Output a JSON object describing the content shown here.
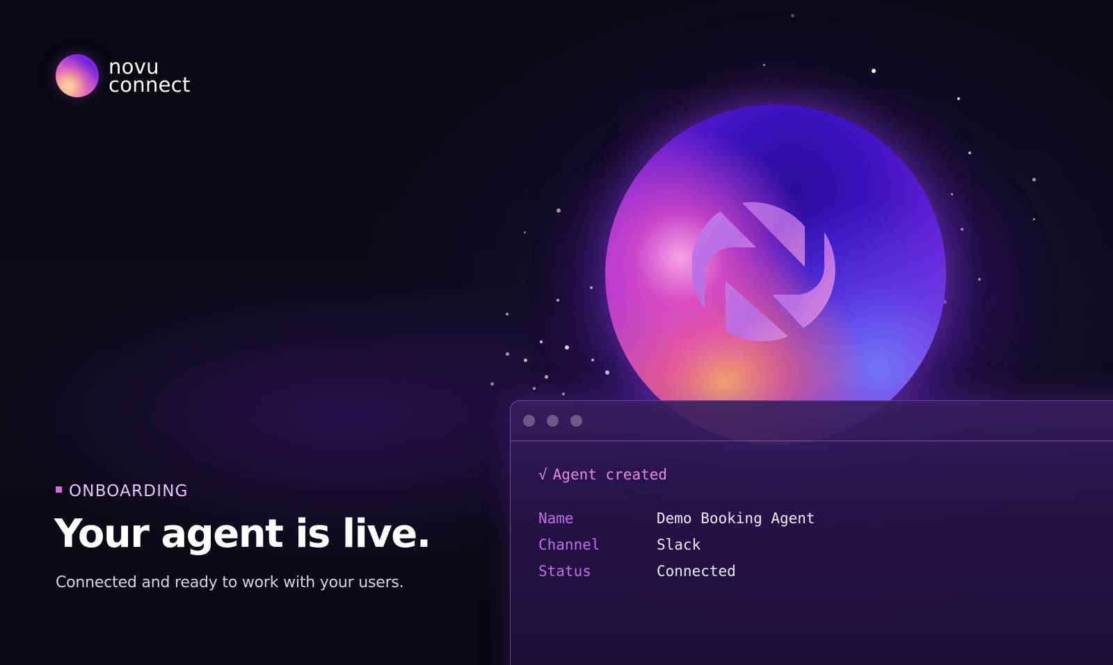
{
  "brand": {
    "line1": "novu",
    "line2": "connect"
  },
  "hero": {
    "eyebrow": "ONBOARDING",
    "headline": "Your agent is live.",
    "subline": "Connected and ready to work with your users."
  },
  "terminal": {
    "status_icon": "√",
    "status_text": "Agent created",
    "rows": [
      {
        "key": "Name",
        "value": "Demo Booking Agent"
      },
      {
        "key": "Channel",
        "value": "Slack"
      },
      {
        "key": "Status",
        "value": "Connected"
      }
    ]
  },
  "colors": {
    "accent": "#d86be6",
    "key_text": "#c06fe8",
    "status_text": "#e38be0",
    "background": "#0b0913"
  },
  "icons": [
    "novu-connect-logo-orb-icon",
    "novu-n-mark-icon",
    "window-control-dot-icon"
  ]
}
